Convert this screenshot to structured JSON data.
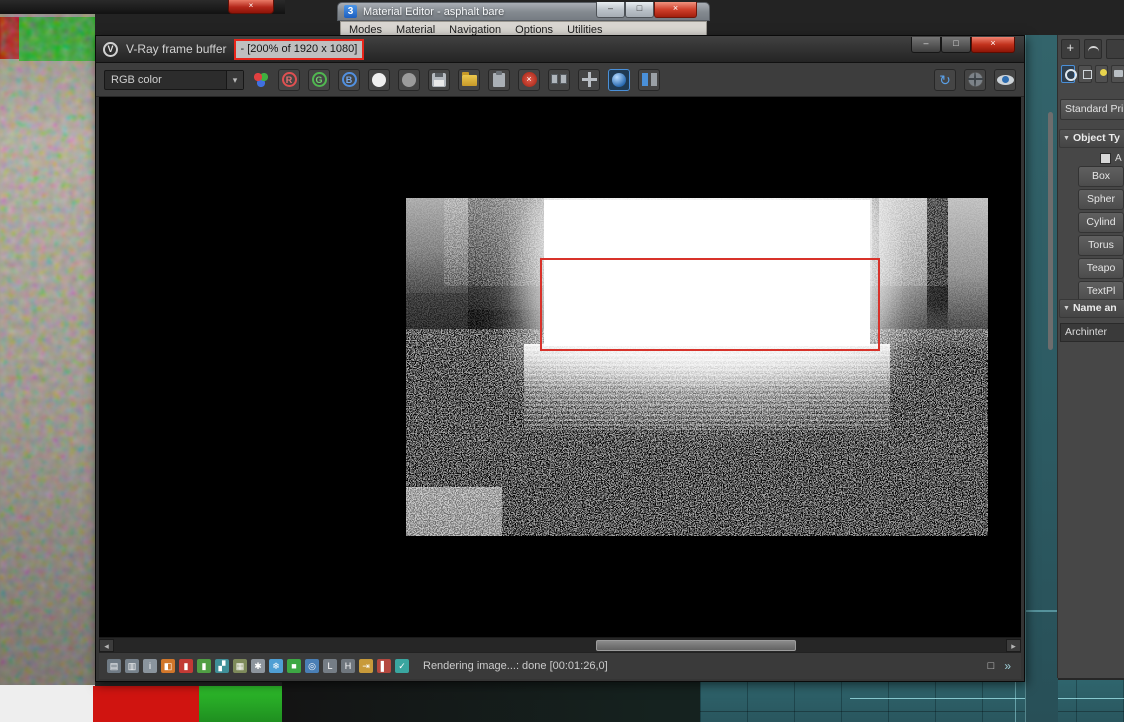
{
  "frag": {
    "close_glyph": "×"
  },
  "material_editor": {
    "logo": "3",
    "title": "Material Editor - asphalt bare",
    "menu": [
      "Modes",
      "Material",
      "Navigation",
      "Options",
      "Utilities"
    ],
    "min_glyph": "–",
    "max_glyph": "□",
    "close_glyph": "×"
  },
  "vfb": {
    "logo_letter": "V",
    "title": "V-Ray frame buffer",
    "zoom_label": "- [200% of 1920 x 1080]",
    "min_glyph": "–",
    "max_glyph": "□",
    "close_glyph": "×",
    "toolbar": {
      "channel_dropdown": "RGB color",
      "dropdown_arrow": "▾",
      "r_label": "R",
      "g_label": "G",
      "b_label": "B",
      "delete_glyph": "×",
      "refresh_glyph": "↻",
      "icon_names": [
        "color-corrections-icon",
        "red-channel-button",
        "green-channel-button",
        "blue-channel-button",
        "alpha-channel-button",
        "monochrome-button",
        "save-image-icon",
        "load-image-icon",
        "clipboard-icon",
        "clear-image-icon",
        "duplicate-buffer-icon",
        "pan-icon",
        "track-mouse-icon",
        "compare-horizontal-icon",
        "refresh-arrow-icon",
        "globe-icon",
        "eye-icon"
      ]
    },
    "scrollbar": {
      "left_glyph": "◂",
      "right_glyph": "▸"
    },
    "status": {
      "text": "Rendering image...: done [00:01:26,0]",
      "corner_glyph": "□",
      "chevron_glyph": "»",
      "icons": [
        {
          "name": "frame-stamp-icon",
          "glyph": "▤",
          "color": "#6f7a84"
        },
        {
          "name": "monitors-icon",
          "glyph": "▥",
          "color": "#77828c"
        },
        {
          "name": "info-icon",
          "glyph": "i",
          "color": "#8a949d"
        },
        {
          "name": "half-res-icon",
          "glyph": "◧",
          "color": "#d1762a"
        },
        {
          "name": "red-levels-icon",
          "glyph": "▮",
          "color": "#c23a35"
        },
        {
          "name": "green-levels-icon",
          "glyph": "▮",
          "color": "#4f9e43"
        },
        {
          "name": "chart-icon",
          "glyph": "▞",
          "color": "#3f8f98"
        },
        {
          "name": "image-icon",
          "glyph": "▦",
          "color": "#7d8a5a"
        },
        {
          "name": "gear-icon",
          "glyph": "✱",
          "color": "#8d959d"
        },
        {
          "name": "snowflake-icon",
          "glyph": "❄",
          "color": "#4f9fd4"
        },
        {
          "name": "green-swatch-icon",
          "glyph": "■",
          "color": "#3da844"
        },
        {
          "name": "vray-sphere-icon",
          "glyph": "◎",
          "color": "#4a7fb5"
        },
        {
          "name": "lut-icon",
          "glyph": "L",
          "color": "#757d85"
        },
        {
          "name": "h-stamp-icon",
          "glyph": "H",
          "color": "#6f767d"
        },
        {
          "name": "clamp-icon",
          "glyph": "⇥",
          "color": "#c89a3a"
        },
        {
          "name": "il-bars-icon",
          "glyph": "▌",
          "color": "#b5483f"
        },
        {
          "name": "check-icon",
          "glyph": "✓",
          "color": "#3aa6a0"
        }
      ]
    }
  },
  "command_panel": {
    "create_tab_glyph": "+",
    "dropdown_label": "Standard Prim",
    "rollout_arrow": "▼",
    "object_type_rollout": "Object Ty",
    "autogrid_label": "A",
    "object_buttons": [
      "Box",
      "Spher",
      "Cylind",
      "Torus",
      "Teapo",
      "TextPl"
    ],
    "name_rollout": "Name an",
    "name_value": "Archinter"
  }
}
